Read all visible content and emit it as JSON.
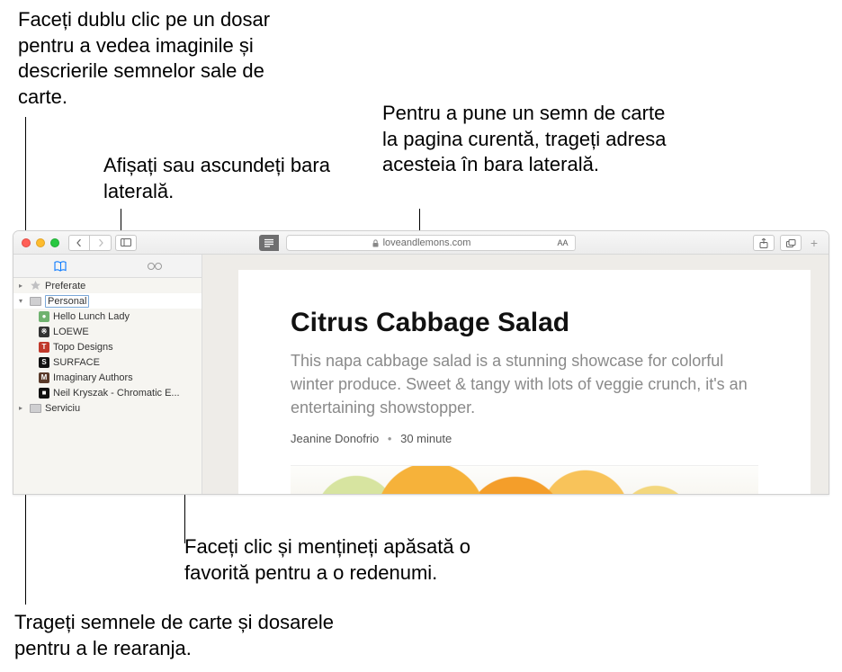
{
  "callouts": {
    "double_click": "Faceți dublu clic pe un dosar pentru a vedea imaginile și descrierile semnelor sale de carte.",
    "show_hide": "Afișați sau ascundeți bara laterală.",
    "bookmark_drag": "Pentru a pune un semn de carte la pagina curentă, trageți adresa acesteia în bara laterală.",
    "rename": "Faceți clic și mențineți apăsată o favorită pentru a o redenumi.",
    "reorder": "Trageți semnele de carte și dosarele pentru a le rearanja."
  },
  "toolbar": {
    "url_host": "loveandlemons.com",
    "textsize_label": "AA"
  },
  "sidebar": {
    "folders": [
      {
        "name": "Preferate",
        "expanded": false,
        "selected": false
      },
      {
        "name": "Personal",
        "expanded": true,
        "selected": true,
        "items": [
          {
            "label": "Hello Lunch Lady",
            "icon_letter": "●",
            "icon_bg": "#6fb26f"
          },
          {
            "label": "LOEWE",
            "icon_letter": "※",
            "icon_bg": "#333"
          },
          {
            "label": "Topo Designs",
            "icon_letter": "T",
            "icon_bg": "#c0392b"
          },
          {
            "label": "SURFACE",
            "icon_letter": "S",
            "icon_bg": "#111"
          },
          {
            "label": "Imaginary Authors",
            "icon_letter": "M",
            "icon_bg": "#5a3a2a"
          },
          {
            "label": "Neil Kryszak - Chromatic E...",
            "icon_letter": "■",
            "icon_bg": "#111"
          }
        ]
      },
      {
        "name": "Serviciu",
        "expanded": false,
        "selected": false
      }
    ]
  },
  "page": {
    "title": "Citrus Cabbage Salad",
    "description": "This napa cabbage salad is a stunning showcase for colorful winter produce. Sweet & tangy with lots of veggie crunch, it's an entertaining showstopper.",
    "author": "Jeanine Donofrio",
    "duration": "30 minute"
  }
}
